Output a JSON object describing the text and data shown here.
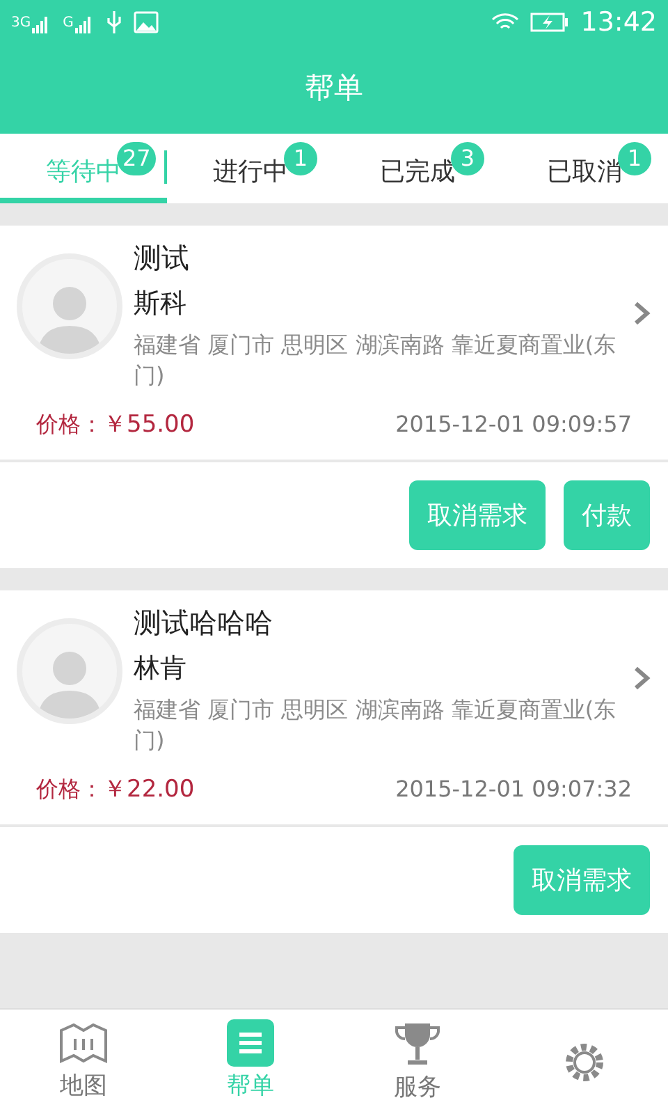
{
  "status_bar": {
    "networks": [
      "3G",
      "G"
    ],
    "time": "13:42"
  },
  "header": {
    "title": "帮单"
  },
  "tabs": [
    {
      "label": "等待中",
      "count": "27",
      "selected": true
    },
    {
      "label": "进行中",
      "count": "1",
      "selected": false
    },
    {
      "label": "已完成",
      "count": "3",
      "selected": false
    },
    {
      "label": "已取消",
      "count": "1",
      "selected": false
    }
  ],
  "orders": [
    {
      "title": "测试",
      "name": "斯科",
      "address": "福建省 厦门市 思明区 湖滨南路 靠近夏商置业(东门)",
      "price_label": "价格：",
      "price": "￥55.00",
      "time": "2015-12-01 09:09:57",
      "actions": [
        "取消需求",
        "付款"
      ]
    },
    {
      "title": "测试哈哈哈",
      "name": "林肯",
      "address": "福建省 厦门市 思明区 湖滨南路 靠近夏商置业(东门)",
      "price_label": "价格：",
      "price": "￥22.00",
      "time": "2015-12-01 09:07:32",
      "actions": [
        "取消需求"
      ]
    }
  ],
  "bottom_nav": [
    {
      "kind": "map",
      "label": "地图",
      "selected": false
    },
    {
      "kind": "list",
      "label": "帮单",
      "selected": true
    },
    {
      "kind": "trophy",
      "label": "服务",
      "selected": false
    },
    {
      "kind": "gear",
      "selected": false
    }
  ]
}
